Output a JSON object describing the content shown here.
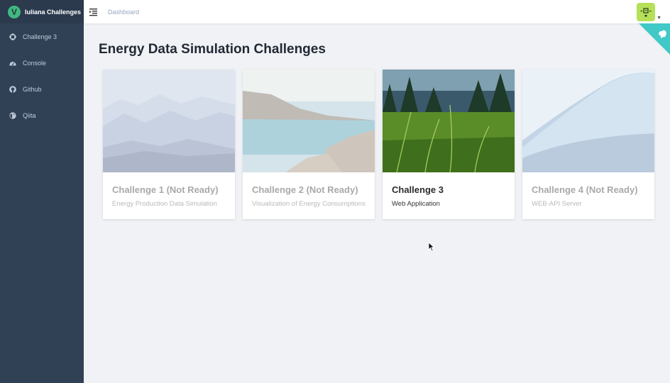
{
  "app": {
    "logo_letter": "V",
    "title": "Iuliana Challenges"
  },
  "sidebar": {
    "items": [
      {
        "label": "Challenge 3",
        "icon": "crosshair-icon"
      },
      {
        "label": "Console",
        "icon": "dashboard-gauge-icon"
      },
      {
        "label": "Github",
        "icon": "github-icon"
      },
      {
        "label": "Qiita",
        "icon": "globe-icon"
      }
    ]
  },
  "navbar": {
    "breadcrumb": "Dashboard",
    "avatar_icon": "robot-avatar-icon"
  },
  "page": {
    "title": "Energy Data Simulation Challenges"
  },
  "cards": [
    {
      "title": "Challenge 1 (Not Ready)",
      "subtitle": "Energy Production Data Simulation",
      "image": "misty-mountains-photo",
      "enabled": false
    },
    {
      "title": "Challenge 2 (Not Ready)",
      "subtitle": "Visualization of Energy Consumptions",
      "image": "rocky-coast-photo",
      "enabled": false
    },
    {
      "title": "Challenge 3",
      "subtitle": "Web Application",
      "image": "grass-field-photo",
      "enabled": true
    },
    {
      "title": "Challenge 4 (Not Ready)",
      "subtitle": "WEB-API Server",
      "image": "ocean-wave-photo",
      "enabled": false
    }
  ],
  "colors": {
    "sidebar_bg": "#304156",
    "accent": "#41b883",
    "corner": "#40c9c6"
  }
}
